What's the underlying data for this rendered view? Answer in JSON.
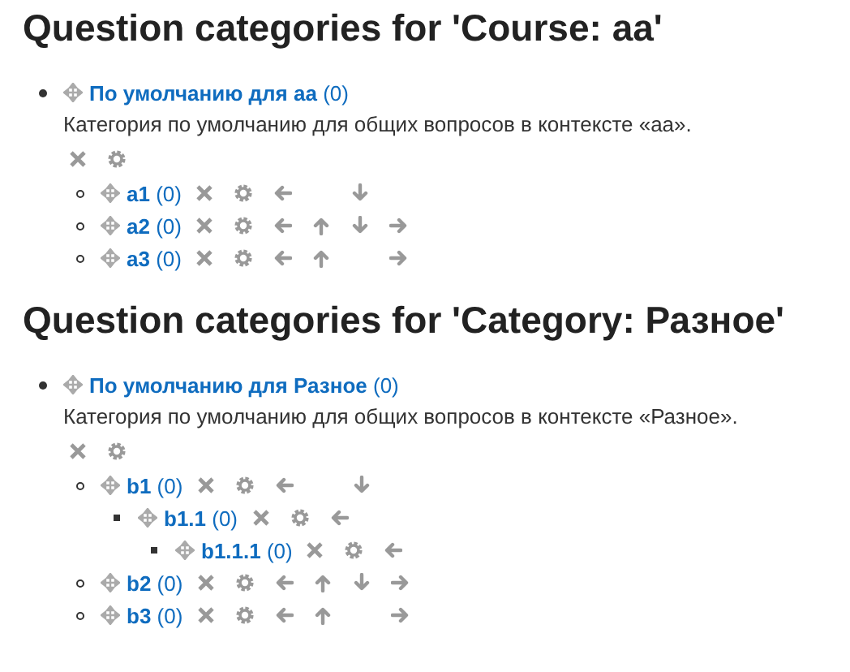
{
  "sections": [
    {
      "heading": "Question categories for 'Course: aa'",
      "category": {
        "name": "По умолчанию для аа",
        "count": "(0)",
        "description": "Категория по умолчанию для общих вопросов в контексте «аа».",
        "children": [
          {
            "name": "a1",
            "count": "(0)",
            "move_left": true,
            "move_up": false,
            "move_down": true,
            "move_right": false
          },
          {
            "name": "a2",
            "count": "(0)",
            "move_left": true,
            "move_up": true,
            "move_down": true,
            "move_right": true
          },
          {
            "name": "a3",
            "count": "(0)",
            "move_left": true,
            "move_up": true,
            "move_down": false,
            "move_right": true
          }
        ]
      }
    },
    {
      "heading": "Question categories for 'Category: Разное'",
      "category": {
        "name": "По умолчанию для Разное",
        "count": "(0)",
        "description": "Категория по умолчанию для общих вопросов в контексте «Разное».",
        "children": [
          {
            "name": "b1",
            "count": "(0)",
            "move_left": true,
            "move_up": false,
            "move_down": true,
            "move_right": false,
            "children": [
              {
                "name": "b1.1",
                "count": "(0)",
                "move_left": true,
                "move_up": false,
                "move_down": false,
                "move_right": false,
                "children": [
                  {
                    "name": "b1.1.1",
                    "count": "(0)",
                    "move_left": true,
                    "move_up": false,
                    "move_down": false,
                    "move_right": false
                  }
                ]
              }
            ]
          },
          {
            "name": "b2",
            "count": "(0)",
            "move_left": true,
            "move_up": true,
            "move_down": true,
            "move_right": true
          },
          {
            "name": "b3",
            "count": "(0)",
            "move_left": true,
            "move_up": true,
            "move_down": false,
            "move_right": true
          }
        ]
      }
    }
  ]
}
